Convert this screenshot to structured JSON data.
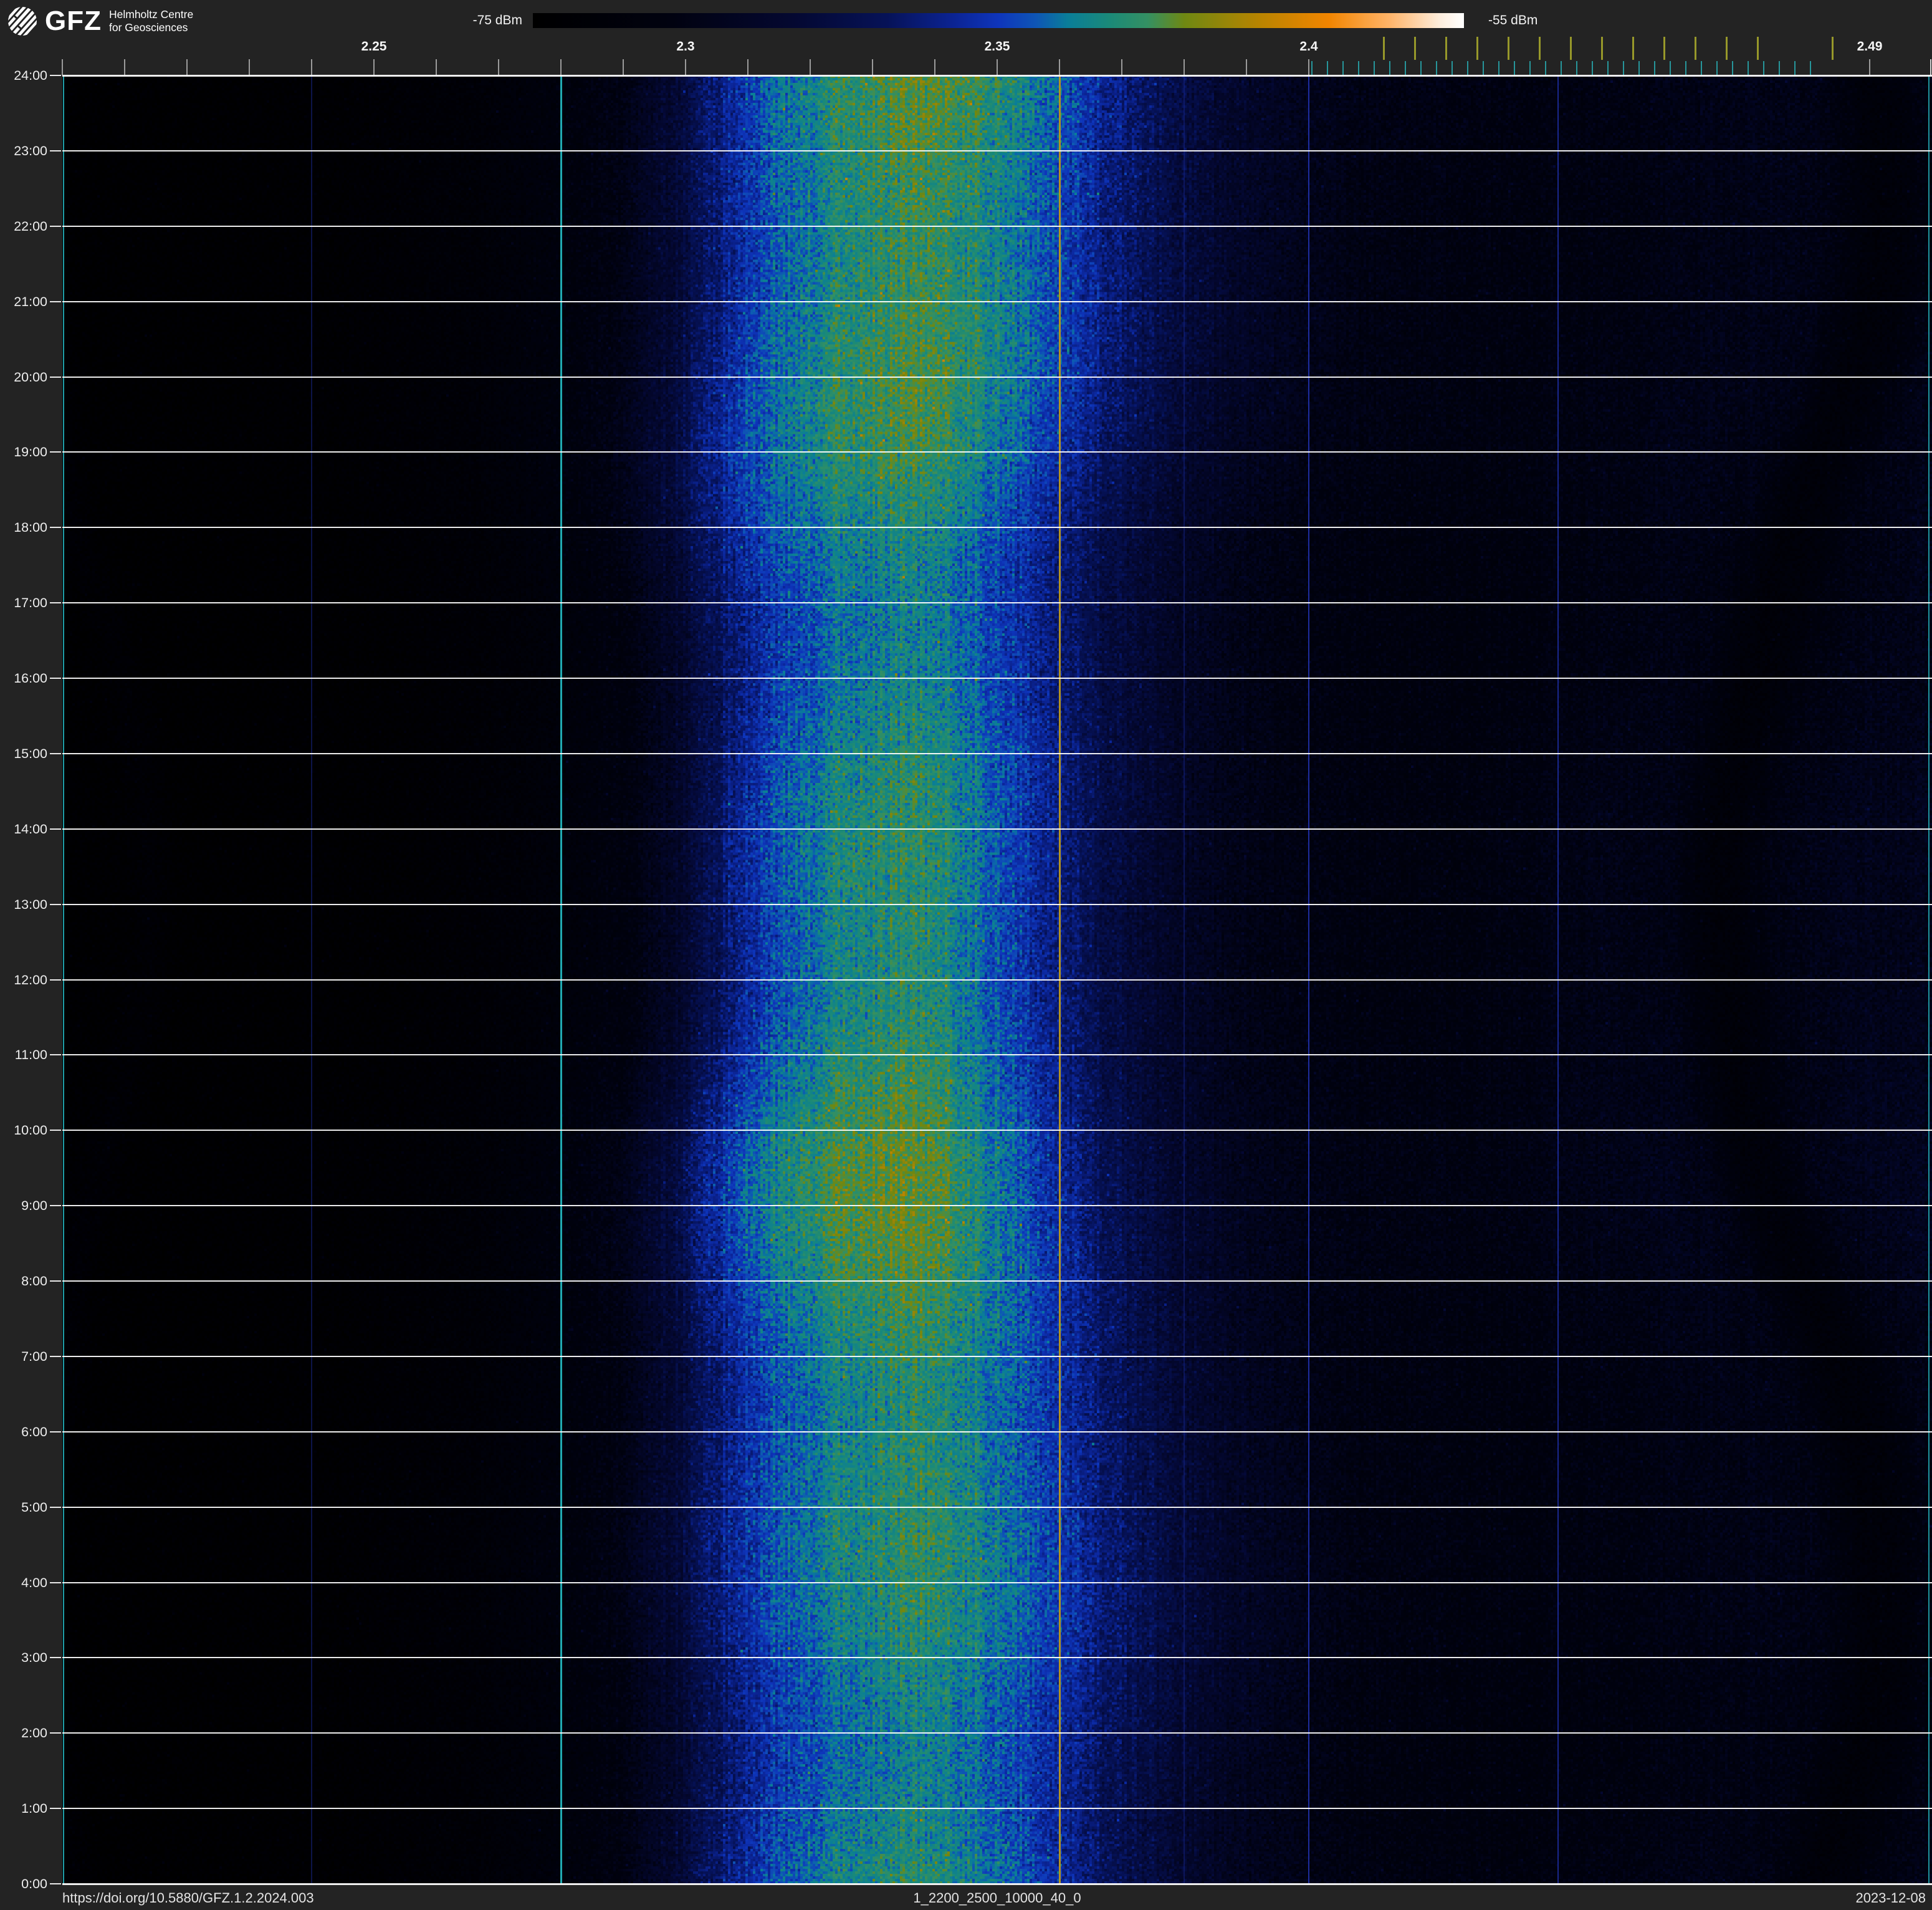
{
  "header": {
    "logo": {
      "brand": "GFZ",
      "subtitle_line1": "Helmholtz Centre",
      "subtitle_line2": "for Geosciences"
    },
    "colorbar": {
      "min_label": "-75 dBm",
      "max_label": "-55 dBm",
      "gradient_stops": [
        {
          "pos": 0.0,
          "color": "#000000"
        },
        {
          "pos": 0.15,
          "color": "#010210"
        },
        {
          "pos": 0.28,
          "color": "#040831"
        },
        {
          "pos": 0.38,
          "color": "#061257"
        },
        {
          "pos": 0.45,
          "color": "#0b2392"
        },
        {
          "pos": 0.5,
          "color": "#0e35bb"
        },
        {
          "pos": 0.54,
          "color": "#0e55b6"
        },
        {
          "pos": 0.575,
          "color": "#0a7e98"
        },
        {
          "pos": 0.62,
          "color": "#1b8a78"
        },
        {
          "pos": 0.66,
          "color": "#349063"
        },
        {
          "pos": 0.7,
          "color": "#6f8812"
        },
        {
          "pos": 0.78,
          "color": "#b88400"
        },
        {
          "pos": 0.855,
          "color": "#f28500"
        },
        {
          "pos": 0.92,
          "color": "#ffb469"
        },
        {
          "pos": 0.975,
          "color": "#fdeede"
        },
        {
          "pos": 1.0,
          "color": "#ffffff"
        }
      ]
    }
  },
  "chart_data": {
    "type": "heatmap",
    "subtype": "radio-spectrogram-waterfall",
    "power_scale_dbm": {
      "min": -75,
      "max": -55
    },
    "x_axis": {
      "unit": "GHz",
      "min": 2.2,
      "max": 2.5,
      "labeled_ticks": [
        {
          "value": 2.25,
          "label": "2.25"
        },
        {
          "value": 2.3,
          "label": "2.3"
        },
        {
          "value": 2.35,
          "label": "2.35"
        },
        {
          "value": 2.4,
          "label": "2.4"
        },
        {
          "value": 2.49,
          "label": "2.49"
        }
      ],
      "minor_ticks": {
        "start": 2.2,
        "end": 2.4,
        "step": 0.01
      },
      "tick_color": "#9b9b9b"
    },
    "ism_band_ticks": {
      "start": 2.4005,
      "end": 2.4805,
      "step": 0.0025,
      "color": "#27969b"
    },
    "wifi_channel_ticks": {
      "color": "#97982a",
      "frequencies": [
        2.412,
        2.417,
        2.422,
        2.427,
        2.432,
        2.437,
        2.442,
        2.447,
        2.452,
        2.457,
        2.462,
        2.467,
        2.472,
        2.484
      ]
    },
    "y_axis": {
      "unit": "time of day",
      "labels": [
        "24:00",
        "23:00",
        "22:00",
        "21:00",
        "20:00",
        "19:00",
        "18:00",
        "17:00",
        "16:00",
        "15:00",
        "14:00",
        "13:00",
        "12:00",
        "11:00",
        "10:00",
        "9:00",
        "8:00",
        "7:00",
        "6:00",
        "5:00",
        "4:00",
        "3:00",
        "2:00",
        "1:00",
        "0:00"
      ],
      "gridline_color": "#ffffff"
    },
    "frequency_markers": [
      {
        "freq": 2.2002,
        "color": "#22a4ae",
        "width": 2,
        "opacity": 0.95,
        "name": "band-start-marker"
      },
      {
        "freq": 2.24,
        "color": "#1b2da0",
        "width": 2,
        "opacity": 0.45,
        "name": "grid-2p24"
      },
      {
        "freq": 2.28,
        "color": "#21aab2",
        "width": 3,
        "opacity": 1.0,
        "name": "teal-marker-2p28"
      },
      {
        "freq": 2.36,
        "color": "#b29222",
        "width": 3,
        "opacity": 1.0,
        "name": "gold-marker-2p36"
      },
      {
        "freq": 2.38,
        "color": "#1b2da0",
        "width": 2,
        "opacity": 0.4,
        "name": "grid-2p38"
      },
      {
        "freq": 2.4,
        "color": "#2438c0",
        "width": 2,
        "opacity": 0.8,
        "name": "grid-2p40"
      },
      {
        "freq": 2.44,
        "color": "#2438c0",
        "width": 2,
        "opacity": 0.7,
        "name": "grid-2p44"
      },
      {
        "freq": 2.4995,
        "color": "#22a4ae",
        "width": 2,
        "opacity": 0.9,
        "name": "band-end-marker"
      }
    ],
    "power_profile_dbm": [
      [
        2.2,
        -74.5
      ],
      [
        2.205,
        -74.0
      ],
      [
        2.21,
        -74.6
      ],
      [
        2.248,
        -74.4
      ],
      [
        2.27,
        -73.6
      ],
      [
        2.29,
        -72.0
      ],
      [
        2.3,
        -69.0
      ],
      [
        2.306,
        -66.6
      ],
      [
        2.312,
        -64.8
      ],
      [
        2.32,
        -63.4
      ],
      [
        2.328,
        -62.5
      ],
      [
        2.336,
        -62.2
      ],
      [
        2.344,
        -62.6
      ],
      [
        2.35,
        -63.6
      ],
      [
        2.356,
        -64.8
      ],
      [
        2.362,
        -66.2
      ],
      [
        2.37,
        -68.0
      ],
      [
        2.38,
        -69.8
      ],
      [
        2.39,
        -71.0
      ],
      [
        2.4,
        -71.8
      ],
      [
        2.415,
        -72.1
      ],
      [
        2.43,
        -72.2
      ],
      [
        2.445,
        -71.9
      ],
      [
        2.46,
        -71.5
      ],
      [
        2.47,
        -71.8
      ],
      [
        2.4775,
        -73.3
      ],
      [
        2.482,
        -73.0
      ],
      [
        2.488,
        -71.9
      ],
      [
        2.5,
        -71.2
      ]
    ],
    "noise_sigma_db": 1.2,
    "band_center_ghz": 2.333,
    "time_drift_ghz": 0.003
  },
  "footer": {
    "doi": "https://doi.org/10.5880/GFZ.1.2.2024.003",
    "dataset_id": "1_2200_2500_10000_40_0",
    "date": "2023-12-08"
  }
}
